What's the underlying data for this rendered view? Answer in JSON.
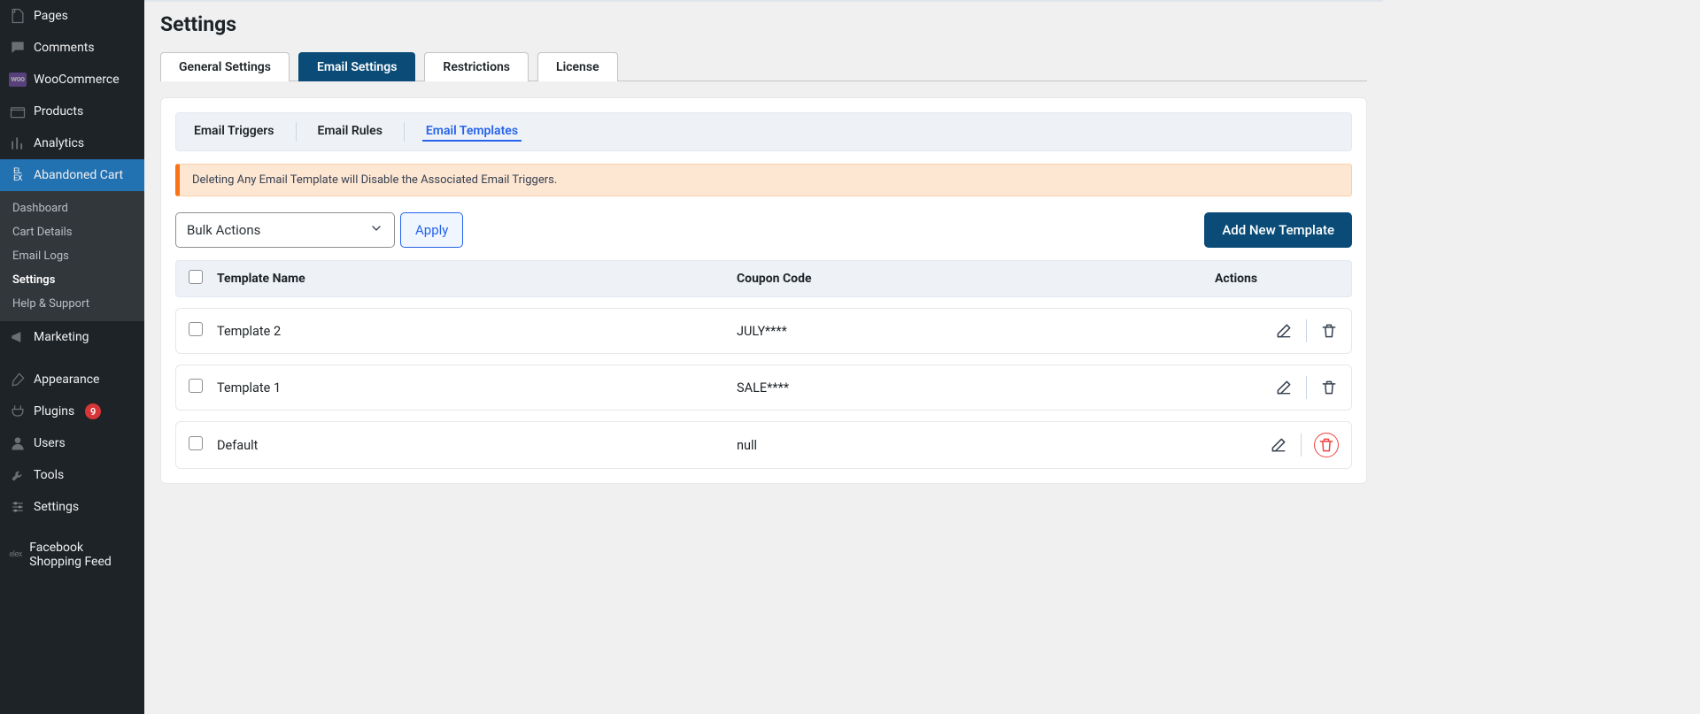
{
  "sidebar": {
    "items": [
      {
        "label": "Pages"
      },
      {
        "label": "Comments"
      },
      {
        "label": "WooCommerce"
      },
      {
        "label": "Products"
      },
      {
        "label": "Analytics"
      },
      {
        "label": "Abandoned Cart"
      },
      {
        "label": "Marketing"
      },
      {
        "label": "Appearance"
      },
      {
        "label": "Plugins",
        "badge": "9"
      },
      {
        "label": "Users"
      },
      {
        "label": "Tools"
      },
      {
        "label": "Settings"
      },
      {
        "label": "Facebook Shopping Feed"
      }
    ],
    "submenu": [
      {
        "label": "Dashboard"
      },
      {
        "label": "Cart Details"
      },
      {
        "label": "Email Logs"
      },
      {
        "label": "Settings"
      },
      {
        "label": "Help & Support"
      }
    ]
  },
  "page": {
    "title": "Settings"
  },
  "primary_tabs": [
    {
      "label": "General Settings"
    },
    {
      "label": "Email Settings"
    },
    {
      "label": "Restrictions"
    },
    {
      "label": "License"
    }
  ],
  "sub_tabs": [
    {
      "label": "Email Triggers"
    },
    {
      "label": "Email Rules"
    },
    {
      "label": "Email Templates"
    }
  ],
  "alert": {
    "text": "Deleting Any Email Template will Disable the Associated Email Triggers."
  },
  "toolbar": {
    "bulk_label": "Bulk Actions",
    "apply_label": "Apply",
    "add_label": "Add New Template"
  },
  "table": {
    "headers": {
      "name": "Template Name",
      "coupon": "Coupon Code",
      "actions": "Actions"
    },
    "rows": [
      {
        "name": "Template 2",
        "coupon": "JULY****"
      },
      {
        "name": "Template 1",
        "coupon": "SALE****"
      },
      {
        "name": "Default",
        "coupon": "null"
      }
    ]
  }
}
